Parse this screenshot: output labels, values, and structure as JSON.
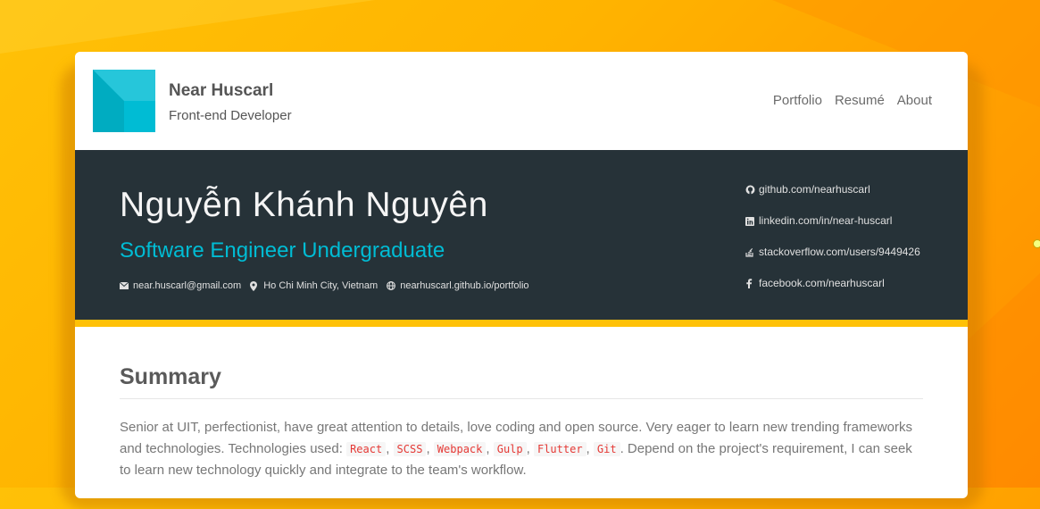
{
  "header": {
    "brand_name": "Near Huscarl",
    "brand_role": "Front-end Developer",
    "nav": [
      "Portfolio",
      "Resumé",
      "About"
    ]
  },
  "hero": {
    "name": "Nguyễn Khánh Nguyên",
    "title": "Software Engineer Undergraduate",
    "contacts": {
      "email": "near.huscarl@gmail.com",
      "location": "Ho Chi Minh City, Vietnam",
      "website": "nearhuscarl.github.io/portfolio"
    },
    "social": {
      "github": "github.com/nearhuscarl",
      "linkedin": "linkedin.com/in/near-huscarl",
      "stackoverflow": "stackoverflow.com/users/9449426",
      "facebook": "facebook.com/nearhuscarl"
    }
  },
  "summary": {
    "title": "Summary",
    "text_before": "Senior at UIT, perfectionist, have great attention to details, love coding and open source. Very eager to learn new trending frameworks and technologies. Technologies used: ",
    "technologies": [
      "React",
      "SCSS",
      "Webpack",
      "Gulp",
      "Flutter",
      "Git"
    ],
    "text_after": ". Depend on the project's requirement, I can seek to learn new technology quickly and integrate to the team's workflow."
  },
  "colors": {
    "accent": "#00bcd4",
    "hero_bg": "#263238",
    "highlight": "#ffc107",
    "code_text": "#e53935"
  },
  "icons": [
    "envelope-icon",
    "map-marker-icon",
    "globe-icon",
    "github-icon",
    "linkedin-icon",
    "stackoverflow-icon",
    "facebook-icon"
  ]
}
